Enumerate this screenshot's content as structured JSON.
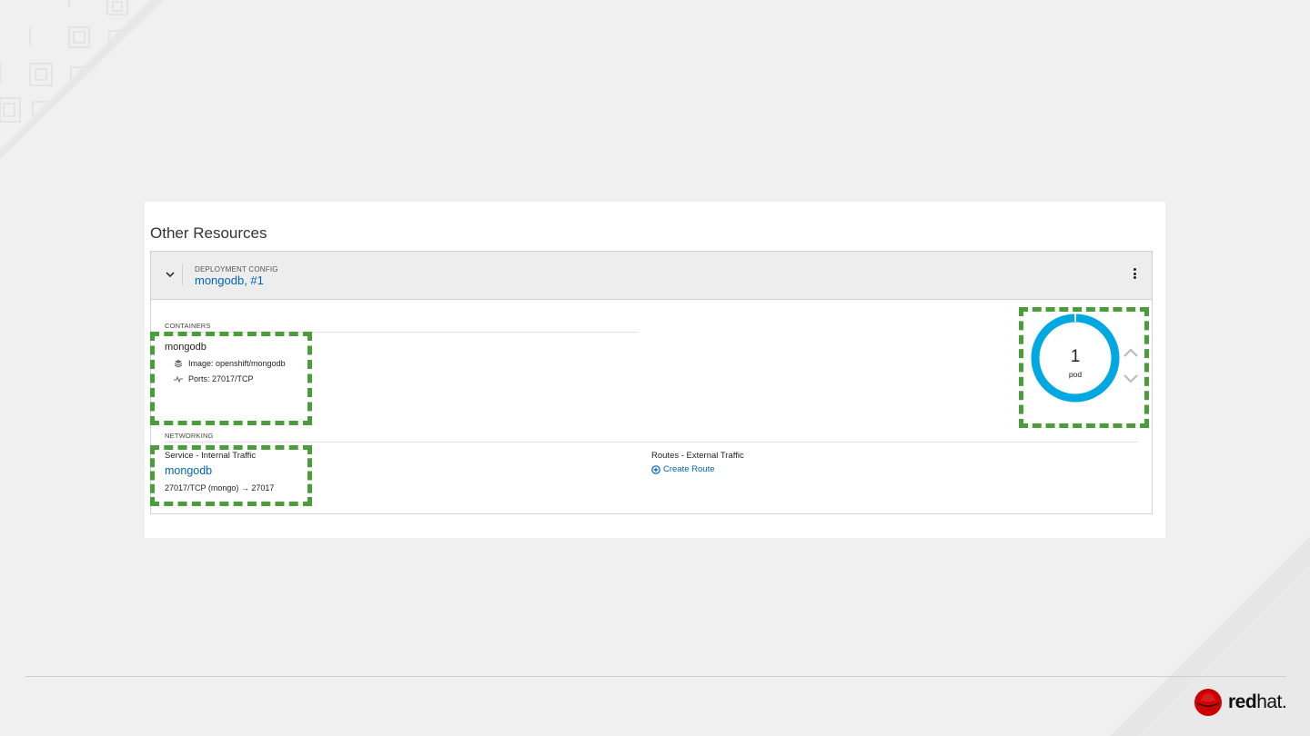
{
  "section_title": "Other Resources",
  "deployment": {
    "kind": "Deployment Config",
    "name": "mongodb, #1"
  },
  "containers": {
    "label": "Containers",
    "name": "mongodb",
    "image": "Image: openshift/mongodb",
    "ports": "Ports: 27017/TCP"
  },
  "networking": {
    "label": "Networking",
    "service_label": "Service - Internal Traffic",
    "service_name": "mongodb",
    "service_ports": "27017/TCP (mongo) → 27017",
    "routes_label": "Routes - External Traffic",
    "create_route": "Create Route"
  },
  "pods": {
    "count": "1",
    "label": "pod"
  },
  "brand": {
    "logo_text_bold": "red",
    "logo_text_thin": "hat.",
    "link_color": "#0066b3",
    "donut_color": "#00a8e1",
    "highlight_color": "#4a9e3a"
  },
  "icons": [
    "chevron-down-icon",
    "kebab-icon",
    "layers-icon",
    "pulse-icon",
    "plus-circle-icon",
    "chevron-up-icon",
    "redhat-logo"
  ]
}
